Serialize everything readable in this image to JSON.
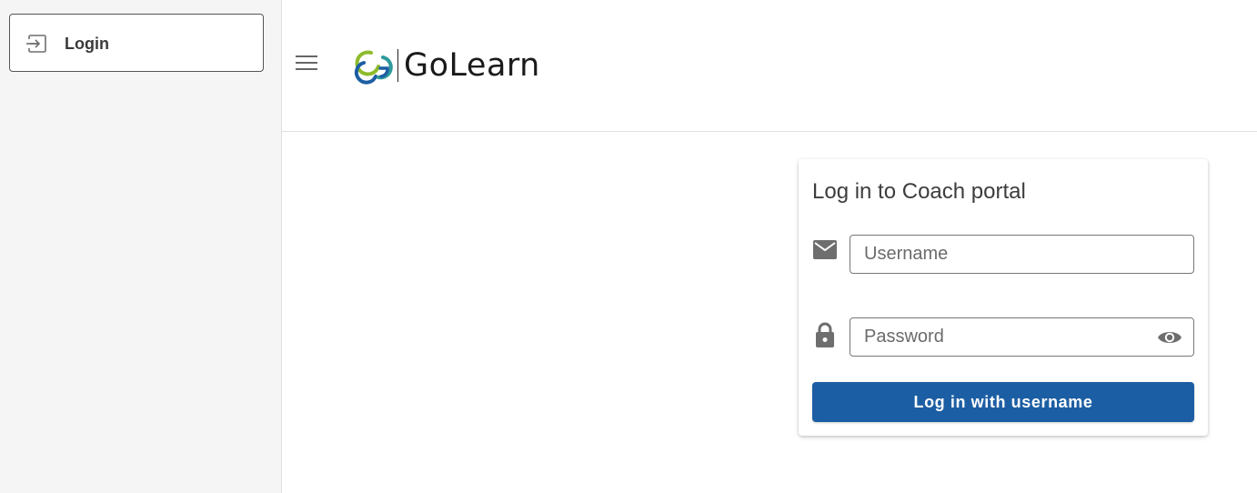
{
  "sidebar": {
    "items": [
      {
        "label": "Login",
        "icon": "login-icon"
      }
    ]
  },
  "header": {
    "menu_icon": "hamburger-menu-icon",
    "logo": {
      "wordmark": "GoLearn",
      "icon": "golearn-logo-icon"
    }
  },
  "login": {
    "title": "Log in to Coach portal",
    "username": {
      "placeholder": "Username",
      "value": "",
      "icon": "email-icon"
    },
    "password": {
      "placeholder": "Password",
      "value": "",
      "icon": "lock-icon",
      "toggle_icon": "eye-icon"
    },
    "submit_label": "Log in with username"
  },
  "colors": {
    "primary_button": "#1c5ea3",
    "sidebar_bg": "#f5f5f5",
    "icon_gray": "#6e6e6e",
    "logo_green": "#8dbb2a",
    "logo_blue": "#1c5ea3",
    "logo_teal": "#2e9b9b"
  }
}
